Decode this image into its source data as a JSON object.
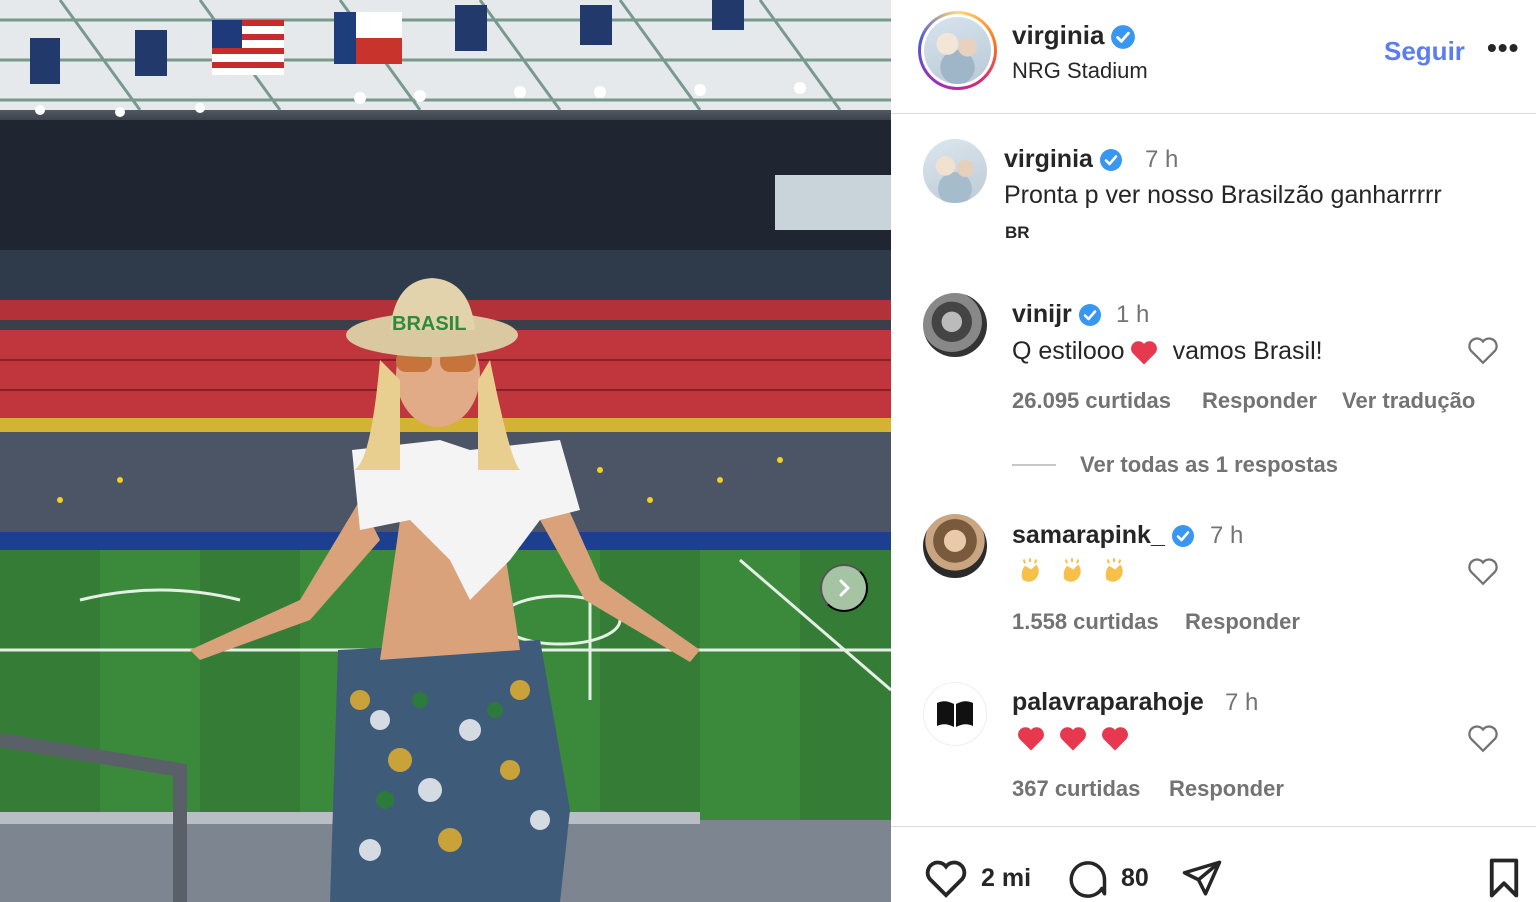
{
  "header": {
    "username": "virginia",
    "location": "NRG Stadium",
    "follow_label": "Seguir",
    "more_label": "•••"
  },
  "photo": {
    "hat_text": "BRASIL"
  },
  "caption": {
    "username": "virginia",
    "time": "7 h",
    "text": "Pronta p ver nosso Brasilzão ganharrrrr",
    "flag_label": "BR"
  },
  "comments": [
    {
      "username": "vinijr",
      "time": "1 h",
      "text_before": "Q estilooo",
      "text_after": "vamos Brasil!",
      "likes": "26.095 curtidas",
      "reply": "Responder",
      "translate": "Ver tradução",
      "view_replies": "Ver todas as 1 respostas"
    },
    {
      "username": "samarapink_",
      "time": "7 h",
      "emojis": [
        "clapping-hands",
        "clapping-hands",
        "clapping-hands"
      ],
      "likes": "1.558 curtidas",
      "reply": "Responder"
    },
    {
      "username": "palavraparahoje",
      "time": "7 h",
      "emojis": [
        "red-heart",
        "red-heart",
        "red-heart"
      ],
      "likes": "367 curtidas",
      "reply": "Responder"
    }
  ],
  "actions": {
    "likes": "2 mi",
    "comments": "80"
  },
  "colors": {
    "follow_blue": "#5b7cf2",
    "verified_blue": "#3897f0",
    "heart_red": "#e63950",
    "muted": "#737373"
  }
}
